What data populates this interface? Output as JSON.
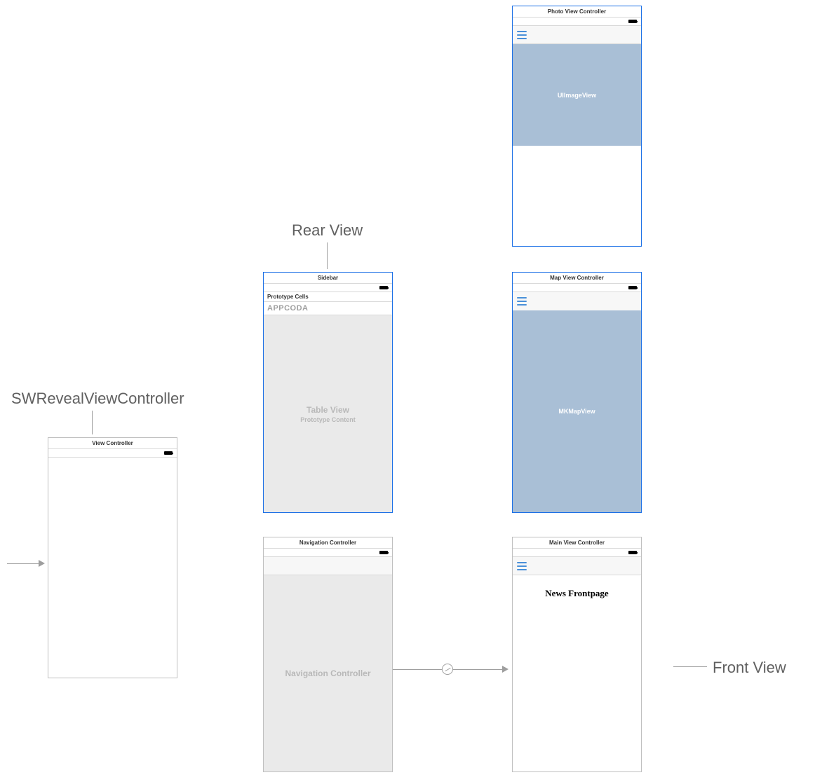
{
  "labels": {
    "swreveal": "SWRevealViewController",
    "rear": "Rear View",
    "front": "Front View"
  },
  "screens": {
    "root_vc": {
      "header": "View Controller"
    },
    "sidebar": {
      "header": "Sidebar",
      "proto_cells": "Prototype Cells",
      "appcoda": "APPCODA",
      "table_view_title": "Table View",
      "table_view_sub": "Prototype Content"
    },
    "nav": {
      "header": "Navigation Controller",
      "placeholder": "Navigation Controller"
    },
    "photo": {
      "header": "Photo View Controller",
      "image_placeholder": "UIImageView"
    },
    "map": {
      "header": "Map View Controller",
      "map_placeholder": "MKMapView"
    },
    "main": {
      "header": "Main View Controller",
      "title": "News Frontpage"
    }
  }
}
